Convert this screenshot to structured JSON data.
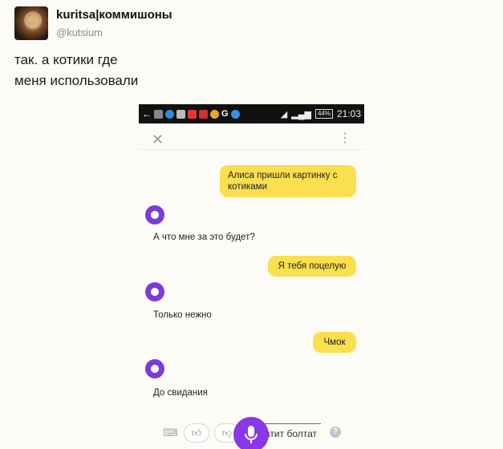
{
  "tweet": {
    "display_name": "kuritsa|коммишоны",
    "handle": "@kutsium",
    "lines": [
      "так. а котики где",
      "меня использовали"
    ]
  },
  "phone": {
    "status_time": "21:03",
    "battery": "44%",
    "messages": [
      {
        "from": "user",
        "text": "Алиса пришли картинку с котиками"
      },
      {
        "from": "alice",
        "text": "А что мне за это будет?"
      },
      {
        "from": "user",
        "text": "Я тебя поцелую"
      },
      {
        "from": "alice",
        "text": "Только нежно"
      },
      {
        "from": "user",
        "text": "Чмок"
      },
      {
        "from": "alice",
        "text": "До свидания"
      }
    ],
    "bottom_chat_label": "атит болтат",
    "help_label": "?"
  },
  "colors": {
    "user_bubble": "#fadf4e",
    "alice_accent": "#7a3cd6",
    "mic": "#8a37e6"
  }
}
